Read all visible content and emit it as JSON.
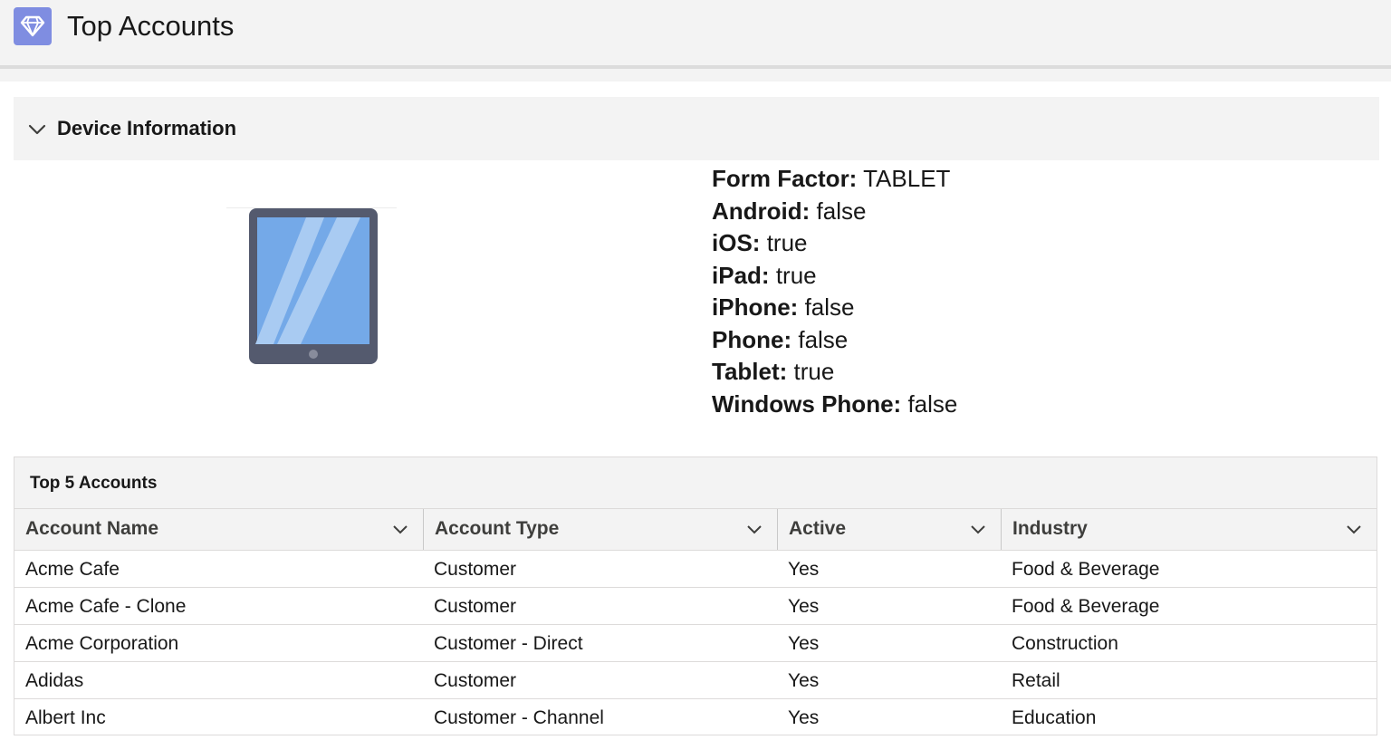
{
  "header": {
    "title": "Top Accounts",
    "icon": "diamond-icon",
    "icon_bg": "#7f8de1"
  },
  "section": {
    "title": "Device Information",
    "toggle_icon": "chevron-down-icon"
  },
  "device": {
    "icon": "tablet-icon",
    "info": [
      {
        "key": "Form Factor:",
        "value": "TABLET"
      },
      {
        "key": "Android:",
        "value": "false"
      },
      {
        "key": "iOS:",
        "value": "true"
      },
      {
        "key": "iPad:",
        "value": "true"
      },
      {
        "key": "iPhone:",
        "value": "false"
      },
      {
        "key": "Phone:",
        "value": "false"
      },
      {
        "key": "Tablet:",
        "value": "true"
      },
      {
        "key": "Windows Phone:",
        "value": "false"
      }
    ]
  },
  "accounts": {
    "title": "Top 5 Accounts",
    "columns": [
      "Account Name",
      "Account Type",
      "Active",
      "Industry"
    ],
    "rows": [
      [
        "Acme Cafe",
        "Customer",
        "Yes",
        "Food & Beverage"
      ],
      [
        "Acme Cafe - Clone",
        "Customer",
        "Yes",
        "Food & Beverage"
      ],
      [
        "Acme Corporation",
        "Customer - Direct",
        "Yes",
        "Construction"
      ],
      [
        "Adidas",
        "Customer",
        "Yes",
        "Retail"
      ],
      [
        "Albert Inc",
        "Customer - Channel",
        "Yes",
        "Education"
      ]
    ]
  }
}
